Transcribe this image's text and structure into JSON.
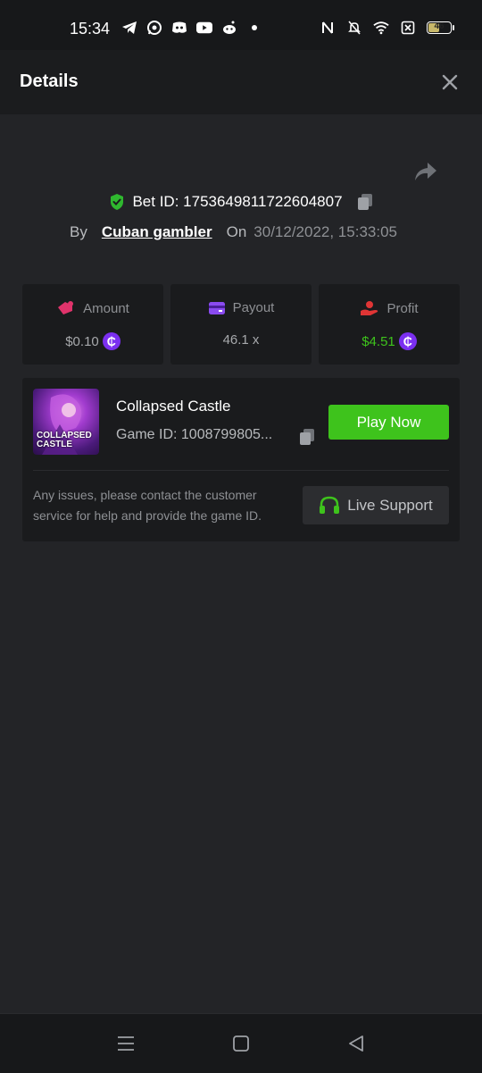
{
  "status_bar": {
    "time": "15:34",
    "battery_level": "46",
    "icons_left": [
      "telegram-icon",
      "whatsapp-icon",
      "discord-icon",
      "youtube-icon",
      "reddit-icon",
      "dot-icon"
    ],
    "icons_right": [
      "nfc-icon",
      "bell-muted-icon",
      "wifi-icon",
      "sim-off-icon",
      "battery-icon"
    ]
  },
  "header": {
    "title": "Details"
  },
  "bet": {
    "id_text": "Bet ID: 1753649811722604807",
    "by_label": "By",
    "user": "Cuban gambler",
    "on_label": "On",
    "date": "30/12/2022, 15:33:05"
  },
  "stats": {
    "amount": {
      "label": "Amount",
      "value": "$0.10"
    },
    "payout": {
      "label": "Payout",
      "value": "46.1 x"
    },
    "profit": {
      "label": "Profit",
      "value": "$4.51"
    }
  },
  "coin_symbol": "₵",
  "game": {
    "thumb_line1": "COLLAPSED",
    "thumb_line2": "CASTLE",
    "name": "Collapsed Castle",
    "id_text": "Game ID: 1008799805...",
    "play_label": "Play Now"
  },
  "support": {
    "text": "Any issues, please contact the customer service for help and provide the game ID.",
    "button_label": "Live Support"
  },
  "colors": {
    "accent_green": "#3ec31c",
    "coin_purple": "#7b2ff0",
    "background": "#232427",
    "card": "#1a1b1d"
  }
}
